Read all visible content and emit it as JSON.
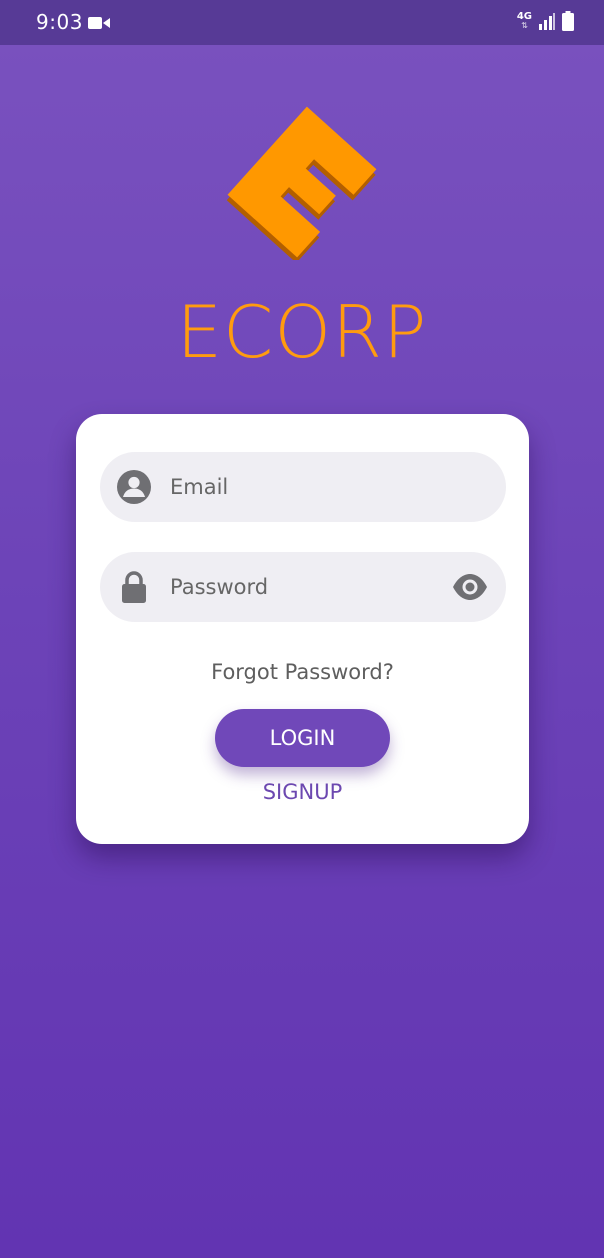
{
  "status_bar": {
    "time": "9:03",
    "network": "4G",
    "icons": [
      "video-camera-icon",
      "network-arrows-icon",
      "signal-icon",
      "battery-icon"
    ]
  },
  "brand": {
    "logo_icon": "ecorp-logo-icon",
    "name": "ECORP",
    "color": "#ff9b0f"
  },
  "login_form": {
    "email": {
      "placeholder": "Email",
      "value": "",
      "icon": "person-icon"
    },
    "password": {
      "placeholder": "Password",
      "value": "",
      "icon": "lock-icon",
      "toggle_icon": "eye-icon"
    },
    "forgot_label": "Forgot Password?",
    "login_label": "LOGIN",
    "signup_label": "SIGNUP"
  },
  "colors": {
    "background": "#6d44b8",
    "accent": "#7048b9",
    "field_bg": "#efeef3"
  }
}
